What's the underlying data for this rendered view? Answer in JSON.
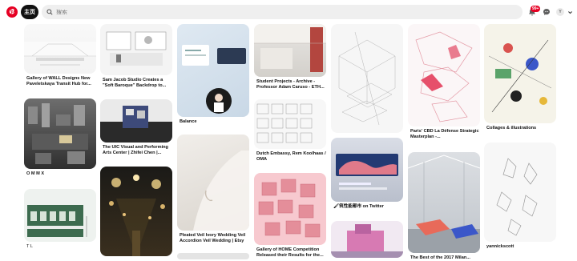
{
  "header": {
    "home_label": "主页",
    "search_placeholder": "搜索",
    "notif_badge": "99+",
    "avatar_initial": "Y"
  },
  "pins": {
    "wall": "Gallery of WALL Designs New Paveletskaya Transit Hub for...",
    "jacob": "Sam Jacob Studio Creates a \"Soft Baroque\" Backdrop to...",
    "balance": "Balance",
    "caruso": "Student Projects - Archive - Professor Adam Caruso - ETH...",
    "paris": "Paris' CBD La Défense Strategic Masterplan -...",
    "collage": "Collages & illustrations",
    "omm": "O M M X",
    "uic": "The UIC Visual and Performing Arts Center | Zhifei Chen |...",
    "veil": "Pleated Veil Ivory Wedding Veil Accordion Veil Wedding | Etsy",
    "dutch": "Dutch Embassy, Rem Koolhaas / OMA",
    "twitter": "🖌筑性能都市 on Twitter",
    "home": "Gallery of HOME Competition Released their Results for the...",
    "milan": "The Best of the 2017 Milan...",
    "yannick": "yannickscott",
    "tl": "T L"
  },
  "colors": {
    "brand": "#e60023",
    "search_bg": "#efefef"
  }
}
